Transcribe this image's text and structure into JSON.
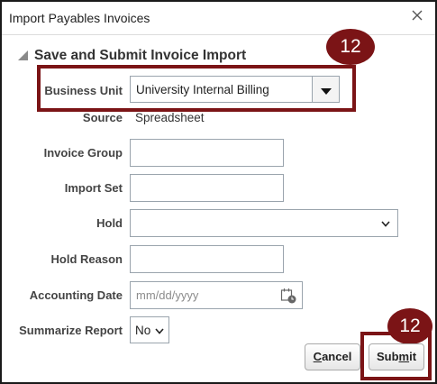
{
  "dialog": {
    "title": "Import Payables Invoices"
  },
  "section": {
    "title": "Save and Submit Invoice Import"
  },
  "callouts": [
    "12",
    "12"
  ],
  "form": {
    "business_unit": {
      "label": "Business Unit",
      "value": "University Internal Billing"
    },
    "source": {
      "label": "Source",
      "value": "Spreadsheet"
    },
    "invoice_group": {
      "label": "Invoice Group",
      "value": ""
    },
    "import_set": {
      "label": "Import Set",
      "value": ""
    },
    "hold": {
      "label": "Hold",
      "value": ""
    },
    "hold_reason": {
      "label": "Hold Reason",
      "value": ""
    },
    "accounting_date": {
      "label": "Accounting Date",
      "placeholder": "mm/dd/yyyy"
    },
    "summarize_report": {
      "label": "Summarize Report",
      "value": "No"
    }
  },
  "buttons": {
    "cancel": {
      "first": "C",
      "rest": "ancel"
    },
    "submit": {
      "pre": "Sub",
      "underlined": "m",
      "post": "it"
    }
  },
  "colors": {
    "accent": "#7b1416",
    "field_border": "#9aa4ad",
    "label": "#444444"
  }
}
